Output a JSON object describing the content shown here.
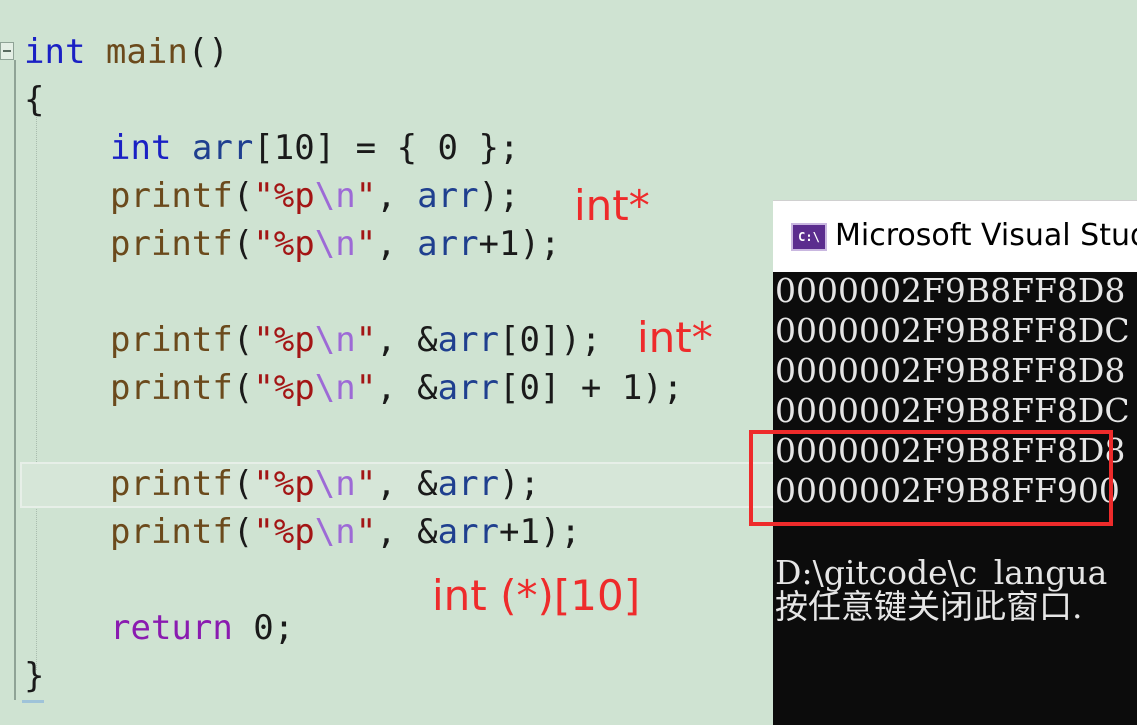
{
  "editor": {
    "lines": {
      "l1_kw": "int",
      "l1_fn": "main",
      "l1_rest": "()",
      "l2": "{",
      "l3_kw": "int",
      "l3_var": "arr",
      "l3_rest": "[10] = { 0 };",
      "l4_fn": "printf",
      "l4_open": "(",
      "l4_str1": "\"%p",
      "l4_esc": "\\n",
      "l4_str2": "\"",
      "l4_comma": ", ",
      "l4_var": "arr",
      "l4_close": ");",
      "l5_fn": "printf",
      "l5_open": "(",
      "l5_str1": "\"%p",
      "l5_esc": "\\n",
      "l5_str2": "\"",
      "l5_comma": ", ",
      "l5_var": "arr",
      "l5_close": "+1);",
      "l6_fn": "printf",
      "l6_open": "(",
      "l6_str1": "\"%p",
      "l6_esc": "\\n",
      "l6_str2": "\"",
      "l6_comma": ", &",
      "l6_var": "arr",
      "l6_close": "[0]);",
      "l7_fn": "printf",
      "l7_open": "(",
      "l7_str1": "\"%p",
      "l7_esc": "\\n",
      "l7_str2": "\"",
      "l7_comma": ", &",
      "l7_var": "arr",
      "l7_close": "[0] + 1);",
      "l8_fn": "printf",
      "l8_open": "(",
      "l8_str1": "\"%p",
      "l8_esc": "\\n",
      "l8_str2": "\"",
      "l8_comma": ", &",
      "l8_var": "arr",
      "l8_close": ");",
      "l9_fn": "printf",
      "l9_open": "(",
      "l9_str1": "\"%p",
      "l9_esc": "\\n",
      "l9_str2": "\"",
      "l9_comma": ", &",
      "l9_var": "arr",
      "l9_close": "+1);",
      "l10_kw": "return",
      "l10_rest": " 0;",
      "l11": "}"
    }
  },
  "annotations": {
    "a1": "int*",
    "a2": "int*",
    "a3": "int (*)[10]"
  },
  "console": {
    "icon_label": "C:\\",
    "title": "Microsoft Visual Studio",
    "output": [
      "0000002F9B8FF8D8",
      "0000002F9B8FF8DC",
      "0000002F9B8FF8D8",
      "0000002F9B8FF8DC",
      "0000002F9B8FF8D8",
      "0000002F9B8FF900"
    ],
    "path_line": "D:\\gitcode\\c_langua",
    "prompt_line": "按任意键关闭此窗口."
  },
  "colors": {
    "editor_bg": "#cfe3d2",
    "keyword": "#1a20c4",
    "annotation": "#ee2b2b",
    "console_bg": "#0c0c0c"
  }
}
